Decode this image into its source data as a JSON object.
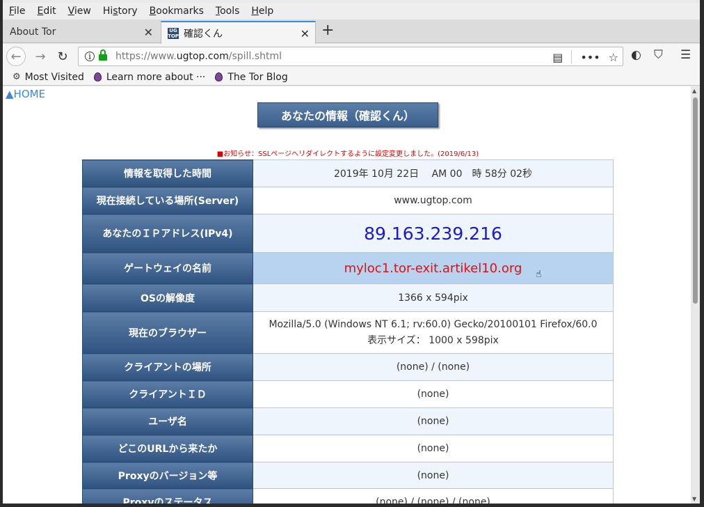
{
  "menu": [
    "File",
    "Edit",
    "View",
    "History",
    "Bookmarks",
    "Tools",
    "Help"
  ],
  "menu_accel": [
    "F",
    "E",
    "V",
    "s",
    "B",
    "T",
    "H"
  ],
  "tabs": [
    {
      "label": "About Tor"
    },
    {
      "label": "確認くん",
      "favicon": "UG TOP"
    }
  ],
  "url": {
    "prefix": "https://www.",
    "domain": "ugtop.com",
    "path": "/spill.shtml"
  },
  "bookmarks": [
    "Most Visited",
    "Learn more about ···",
    "The Tor Blog"
  ],
  "page": {
    "home": "▲HOME",
    "title": "あなたの情報（確認くん）",
    "notice": "■お知らせ：SSLページへリダイレクトするように設定変更しました。(2019/6/13)",
    "rows": [
      {
        "label": "情報を取得した時間",
        "value": "2019年 10月 22日　 AM 00　時 58分 02秒"
      },
      {
        "label": "現在接続している場所(Server)",
        "value": "www.ugtop.com"
      },
      {
        "label": "あなたのＩＰアドレス(IPv4)",
        "value": "89.163.239.216"
      },
      {
        "label": "ゲートウェイの名前",
        "value": "myloc1.tor-exit.artikel10.org"
      },
      {
        "label": "OSの解像度",
        "value": "1366 x 594pix"
      },
      {
        "label": "現在のブラウザー",
        "value": "Mozilla/5.0 (Windows NT 6.1; rv:60.0) Gecko/20100101 Firefox/60.0",
        "value2": "表示サイズ： 1000 x 598pix"
      },
      {
        "label": "クライアントの場所",
        "value": "(none) / (none)"
      },
      {
        "label": "クライアントＩＤ",
        "value": "(none)"
      },
      {
        "label": "ユーザ名",
        "value": "(none)"
      },
      {
        "label": "どこのURLから来たか",
        "value": "(none)"
      },
      {
        "label": "Proxyのバージョン等",
        "value": "(none)"
      },
      {
        "label": "Proxyのステータス",
        "value": "(none) / (none) / (none)"
      }
    ]
  },
  "colors": {
    "accent": "#3a8de0",
    "header_blue": "#3a5f8b",
    "ip_blue": "#1a1acc",
    "gateway_red": "#dd1111"
  }
}
